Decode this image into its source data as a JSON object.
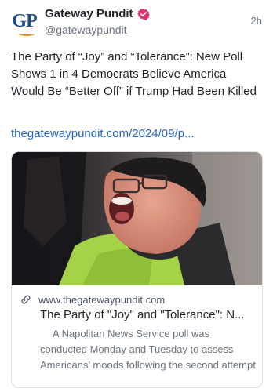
{
  "post": {
    "author_name": "Gateway Pundit",
    "handle": "@gatewaypundit",
    "time_ago": "2h",
    "avatar_text": "GP",
    "text": "The Party of “Joy” and “Tolerance”: New Poll Shows 1 in 4 Democrats Believe America Would Be “Better Off” if Trump Had Been Killed",
    "link_text": "thegatewaypundit.com/2024/09/p..."
  },
  "link_card": {
    "domain": "www.thegatewaypundit.com",
    "title": "The Party of \"Joy\" and \"Tolerance\": N...",
    "description": "A Napolitan News Service poll was conducted Monday and Tuesday to assess Americans’ moods following the second attempt on President Donald Trump’s life at ..."
  },
  "colors": {
    "brand_blue": "#1e4c8a",
    "brand_orange": "#e08a1e",
    "verified_badge": "#d9366b",
    "link": "#2563c9"
  },
  "icons": {
    "verified": "verified-badge-icon",
    "link": "link-chain-icon"
  }
}
